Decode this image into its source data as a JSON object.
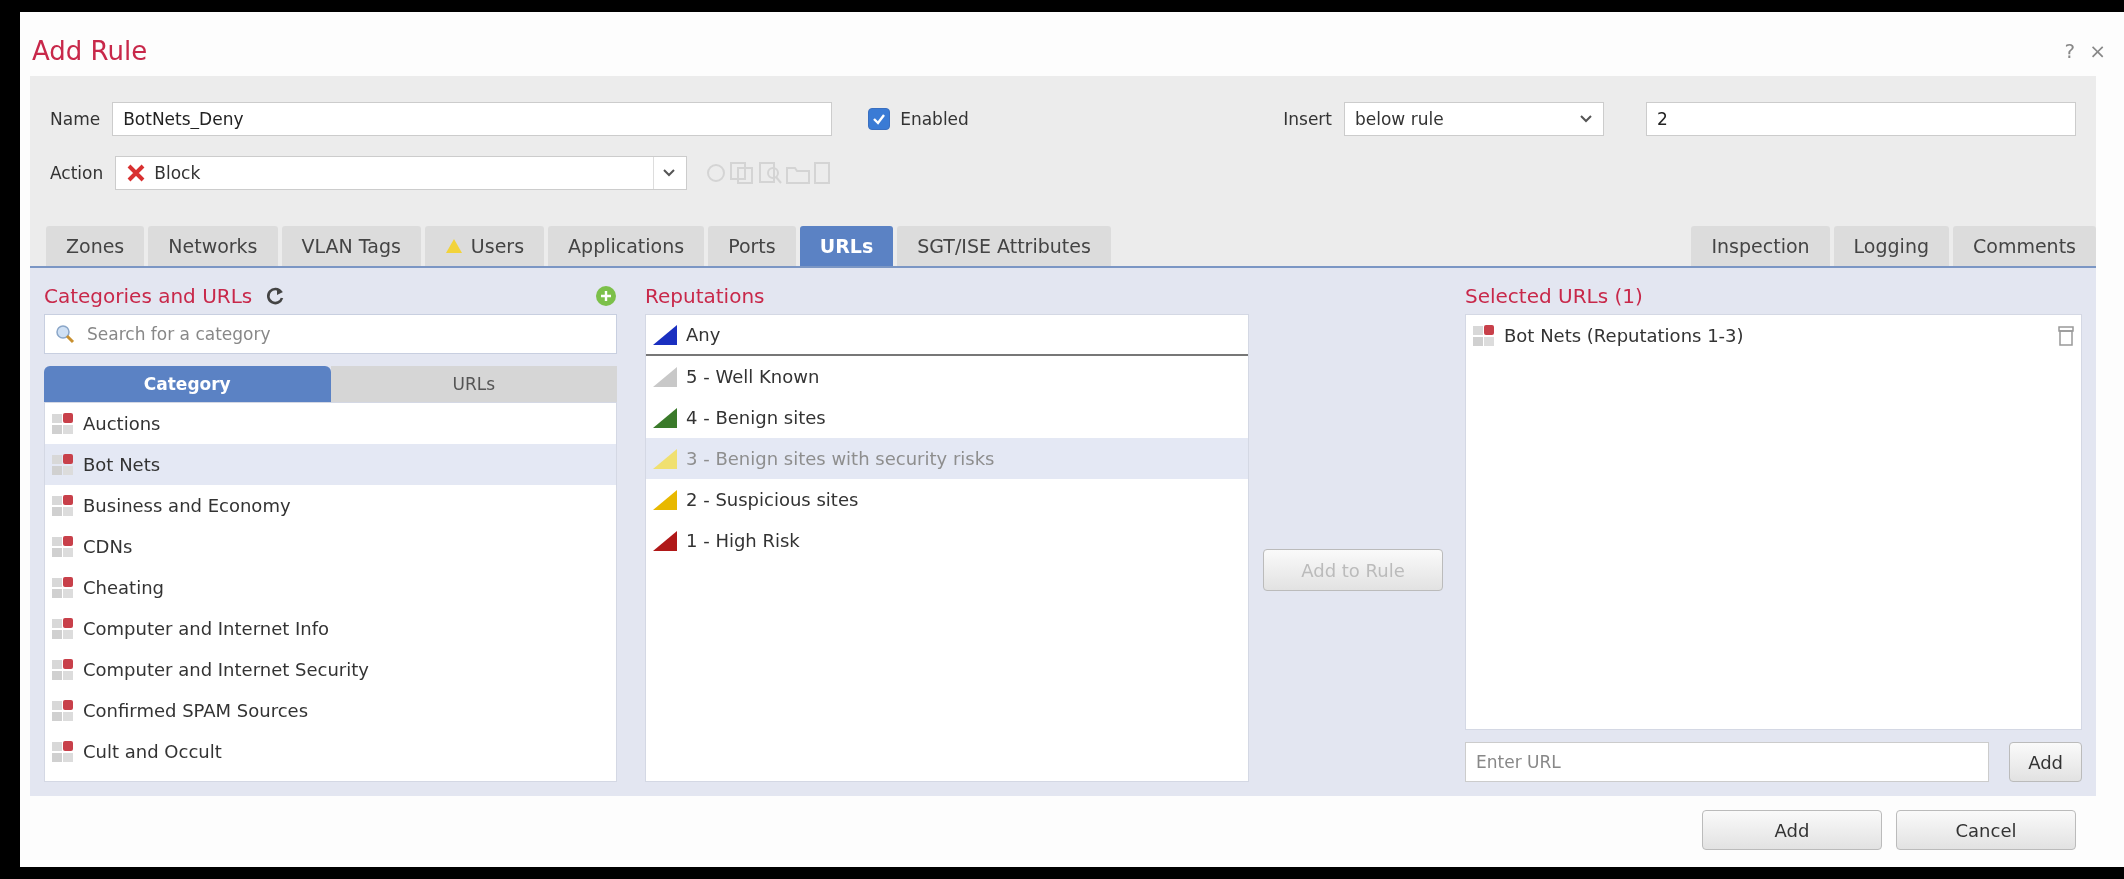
{
  "dialog": {
    "title": "Add Rule",
    "help": "?",
    "close": "×"
  },
  "form": {
    "name_label": "Name",
    "name_value": "BotNets_Deny",
    "enabled_label": "Enabled",
    "enabled": {
      "checked": true
    },
    "insert_label": "Insert",
    "insert_value": "below rule",
    "insert_rule": "2",
    "action_label": "Action",
    "action_value": "Block"
  },
  "tabs": [
    {
      "label": "Zones",
      "selected": false,
      "warning": false
    },
    {
      "label": "Networks",
      "selected": false,
      "warning": false
    },
    {
      "label": "VLAN Tags",
      "selected": false,
      "warning": false
    },
    {
      "label": "Users",
      "selected": false,
      "warning": true
    },
    {
      "label": "Applications",
      "selected": false,
      "warning": false
    },
    {
      "label": "Ports",
      "selected": false,
      "warning": false
    },
    {
      "label": "URLs",
      "selected": true,
      "warning": false
    },
    {
      "label": "SGT/ISE Attributes",
      "selected": false,
      "warning": false
    }
  ],
  "tabs_right": [
    {
      "label": "Inspection",
      "selected": false
    },
    {
      "label": "Logging",
      "selected": false
    },
    {
      "label": "Comments",
      "selected": false
    }
  ],
  "categories_panel": {
    "title": "Categories and URLs",
    "search_placeholder": "Search for a category",
    "subtabs": [
      {
        "label": "Category",
        "selected": true
      },
      {
        "label": "URLs",
        "selected": false
      }
    ],
    "items": [
      {
        "label": "Auctions",
        "selected": false
      },
      {
        "label": "Bot Nets",
        "selected": true
      },
      {
        "label": "Business and Economy",
        "selected": false
      },
      {
        "label": "CDNs",
        "selected": false
      },
      {
        "label": "Cheating",
        "selected": false
      },
      {
        "label": "Computer and Internet Info",
        "selected": false
      },
      {
        "label": "Computer and Internet Security",
        "selected": false
      },
      {
        "label": "Confirmed SPAM Sources",
        "selected": false
      },
      {
        "label": "Cult and Occult",
        "selected": false
      }
    ]
  },
  "reputations_panel": {
    "title": "Reputations",
    "add_button": "Add to Rule",
    "items": [
      {
        "label": "Any",
        "kind": "any",
        "color": "#1a2fc0",
        "selected": false,
        "disabled": false
      },
      {
        "label": "5 - Well Known",
        "kind": "level",
        "color": "#c8c8c8",
        "selected": false,
        "disabled": false
      },
      {
        "label": "4 - Benign sites",
        "kind": "level",
        "color": "#3a7a2a",
        "selected": false,
        "disabled": false
      },
      {
        "label": "3 - Benign sites with security risks",
        "kind": "level",
        "color": "#f0e070",
        "selected": true,
        "disabled": true
      },
      {
        "label": "2 - Suspicious sites",
        "kind": "level",
        "color": "#e8b800",
        "selected": false,
        "disabled": false
      },
      {
        "label": "1 - High Risk",
        "kind": "level",
        "color": "#b01818",
        "selected": false,
        "disabled": false
      }
    ]
  },
  "selected_panel": {
    "title": "Selected URLs (1)",
    "items": [
      {
        "label": "Bot Nets (Reputations 1-3)"
      }
    ],
    "url_placeholder": "Enter URL",
    "add_button": "Add"
  },
  "footer": {
    "buttons": [
      "Add",
      "Cancel"
    ]
  }
}
